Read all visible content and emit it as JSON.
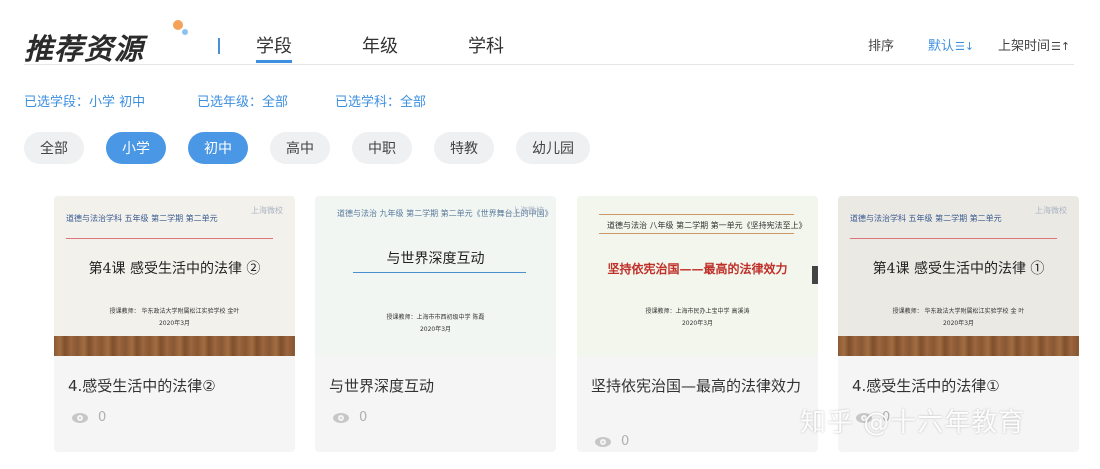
{
  "header": {
    "title": "推荐资源",
    "tabs": [
      {
        "label": "学段",
        "active": true
      },
      {
        "label": "年级",
        "active": false
      },
      {
        "label": "学科",
        "active": false
      }
    ],
    "sort": {
      "label": "排序",
      "options": [
        {
          "label": "默认",
          "arrow": "☰↓",
          "active": true
        },
        {
          "label": "上架时间",
          "arrow": "☰↑",
          "active": false
        }
      ]
    }
  },
  "filters": {
    "selected": [
      "已选学段：小学 初中",
      "已选年级：全部",
      "已选学科：全部"
    ],
    "pills": [
      {
        "label": "全部",
        "selected": false
      },
      {
        "label": "小学",
        "selected": true
      },
      {
        "label": "初中",
        "selected": true
      },
      {
        "label": "高中",
        "selected": false
      },
      {
        "label": "中职",
        "selected": false
      },
      {
        "label": "特教",
        "selected": false
      },
      {
        "label": "幼儿园",
        "selected": false
      }
    ]
  },
  "cards": [
    {
      "title": "4.感受生活中的法律②",
      "views": "0",
      "thumb": {
        "header": "道德与法治学科  五年级  第二学期  第二单元",
        "watermark": "上海微校",
        "lesson": "第4课   感受生活中的法律 ②",
        "teacher": "授课教师：  华东政法大学附属松江实验学校  金叶",
        "date": "2020年3月"
      }
    },
    {
      "title": "与世界深度互动",
      "views": "0",
      "thumb": {
        "header": "道德与法治   九年级   第二学期   第二单元《世界舞台上的中国》",
        "watermark": "上海微校",
        "lesson": "与世界深度互动",
        "teacher": "授课教师：上海市市西初级中学   陈磊",
        "date": "2020年3月"
      }
    },
    {
      "title": "坚持依宪治国—最高的法律效力",
      "views": "0",
      "thumb": {
        "header": "道德与法治   八年级   第二学期   第一单元《坚持宪法至上》",
        "watermark": "",
        "lesson": "坚持依宪治国——最高的法律效力",
        "teacher": "授课教师：上海市民办上宝中学  高溪涛",
        "date": "2020年3月"
      }
    },
    {
      "title": "4.感受生活中的法律①",
      "views": "0",
      "thumb": {
        "header": "道德与法治学科  五年级  第二学期  第二单元",
        "watermark": "上海微校",
        "lesson": "第4课   感受生活中的法律 ①",
        "teacher": "授课教师：  华东政法大学附属松江实验学校   金  叶",
        "date": "2020年3月"
      }
    }
  ],
  "watermark": "知乎 @十六年教育",
  "colors": {
    "accent": "#3d8fe0",
    "pill_on": "#4a97e6",
    "pill_off": "#eef0f2"
  }
}
